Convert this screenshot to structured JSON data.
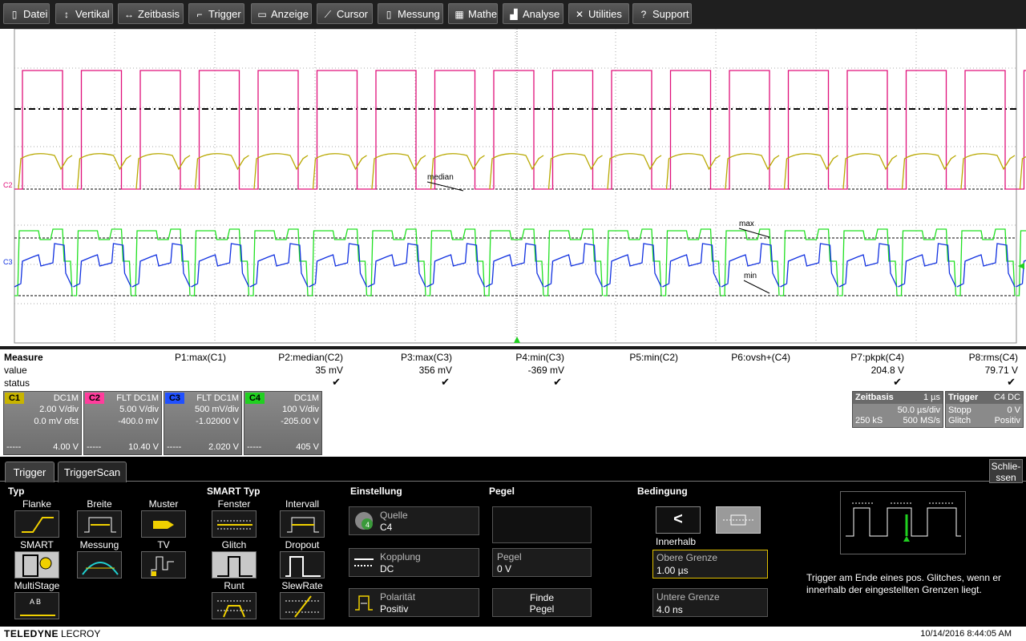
{
  "menu": [
    {
      "label": "Datei",
      "icon": "file-icon",
      "glyph": "▯"
    },
    {
      "label": "Vertikal",
      "icon": "vertical-arrows-icon",
      "glyph": "↕"
    },
    {
      "label": "Zeitbasis",
      "icon": "horizontal-arrows-icon",
      "glyph": "↔"
    },
    {
      "label": "Trigger",
      "icon": "trigger-icon",
      "glyph": "⌐"
    },
    {
      "label": "Anzeige",
      "icon": "display-icon",
      "glyph": "▭"
    },
    {
      "label": "Cursor",
      "icon": "cursor-icon",
      "glyph": "⟋"
    },
    {
      "label": "Messung",
      "icon": "measure-icon",
      "glyph": "▯"
    },
    {
      "label": "Mathe",
      "icon": "calculator-icon",
      "glyph": "▦"
    },
    {
      "label": "Analyse",
      "icon": "analysis-icon",
      "glyph": "▟"
    },
    {
      "label": "Utilities",
      "icon": "tools-icon",
      "glyph": "✕"
    },
    {
      "label": "Support",
      "icon": "support-icon",
      "glyph": "?"
    }
  ],
  "waveform": {
    "c1_label": "C1",
    "c2_label": "C2",
    "c3_label": "C3",
    "markers": {
      "median": "median",
      "max": "max",
      "min": "min"
    }
  },
  "measure": {
    "header": "Measure",
    "row_value": "value",
    "row_status": "status",
    "params": [
      {
        "name": "P1:max(C1)",
        "value": "",
        "ok": false
      },
      {
        "name": "P2:median(C2)",
        "value": "35 mV",
        "ok": true
      },
      {
        "name": "P3:max(C3)",
        "value": "356 mV",
        "ok": true
      },
      {
        "name": "P4:min(C3)",
        "value": "-369 mV",
        "ok": true
      },
      {
        "name": "P5:min(C2)",
        "value": "",
        "ok": false
      },
      {
        "name": "P6:ovsh+(C4)",
        "value": "",
        "ok": false
      },
      {
        "name": "P7:pkpk(C4)",
        "value": "204.8 V",
        "ok": true
      },
      {
        "name": "P8:rms(C4)",
        "value": "79.71 V",
        "ok": true
      }
    ],
    "check": "✔"
  },
  "channels": [
    {
      "tag": "C1",
      "color": "#c8b400",
      "header": "DC1M",
      "l1": "2.00 V/div",
      "l2": "0.0 mV ofst",
      "footer_left": "-----",
      "footer": "4.00 V"
    },
    {
      "tag": "C2",
      "color": "#ff3c9c",
      "header": "FLT  DC1M",
      "l1": "5.00 V/div",
      "l2": "-400.0 mV",
      "footer_left": "-----",
      "footer": "10.40 V"
    },
    {
      "tag": "C3",
      "color": "#2050ff",
      "header": "FLT  DC1M",
      "l1": "500 mV/div",
      "l2": "-1.02000 V",
      "footer_left": "-----",
      "footer": "2.020 V"
    },
    {
      "tag": "C4",
      "color": "#20d020",
      "header": "DC1M",
      "l1": "100 V/div",
      "l2": "-205.00 V",
      "footer_left": "-----",
      "footer": "405 V"
    }
  ],
  "timebase": {
    "title": "Zeitbasis",
    "t_value": "1 µs",
    "rate": "50.0 µs/div",
    "samples": "250 kS",
    "srate": "500 MS/s"
  },
  "trigger_box": {
    "title": "Trigger",
    "src": "C4 DC",
    "mode": "Stopp",
    "level": "0 V",
    "type": "Glitch",
    "slope": "Positiv"
  },
  "tabs": {
    "trigger": "Trigger",
    "triggerscan": "TriggerScan",
    "close": "Schlie-\nssen"
  },
  "dialog": {
    "typ": "Typ",
    "smart_typ": "SMART Typ",
    "einstellung": "Einstellung",
    "pegel": "Pegel",
    "bedingung": "Bedingung",
    "types": [
      "Flanke",
      "Breite",
      "Muster",
      "SMART",
      "Messung",
      "TV",
      "MultiStage"
    ],
    "smart_types": [
      "Fenster",
      "Intervall",
      "Glitch",
      "Dropout",
      "Runt",
      "SlewRate"
    ],
    "quelle_label": "Quelle",
    "quelle_value": "C4",
    "kopplung_label": "Kopplung",
    "kopplung_value": "DC",
    "polaritaet_label": "Polarität",
    "polaritaet_value": "Positiv",
    "pegel_label": "Pegel",
    "pegel_value": "0 V",
    "finde": "Finde",
    "finde2": "Pegel",
    "cond_less": "<",
    "innerhalb": "Innerhalb",
    "obere_label": "Obere Grenze",
    "obere_value": "1.00 µs",
    "untere_label": "Untere Grenze",
    "untere_value": "4.0 ns",
    "description": "Trigger am Ende eines pos. Glitches, wenn er innerhalb der eingestellten Grenzen liegt."
  },
  "status": {
    "brand": "TELEDYNE",
    "brand2": "LECROY",
    "datetime": "10/14/2016 8:44:05 AM"
  }
}
